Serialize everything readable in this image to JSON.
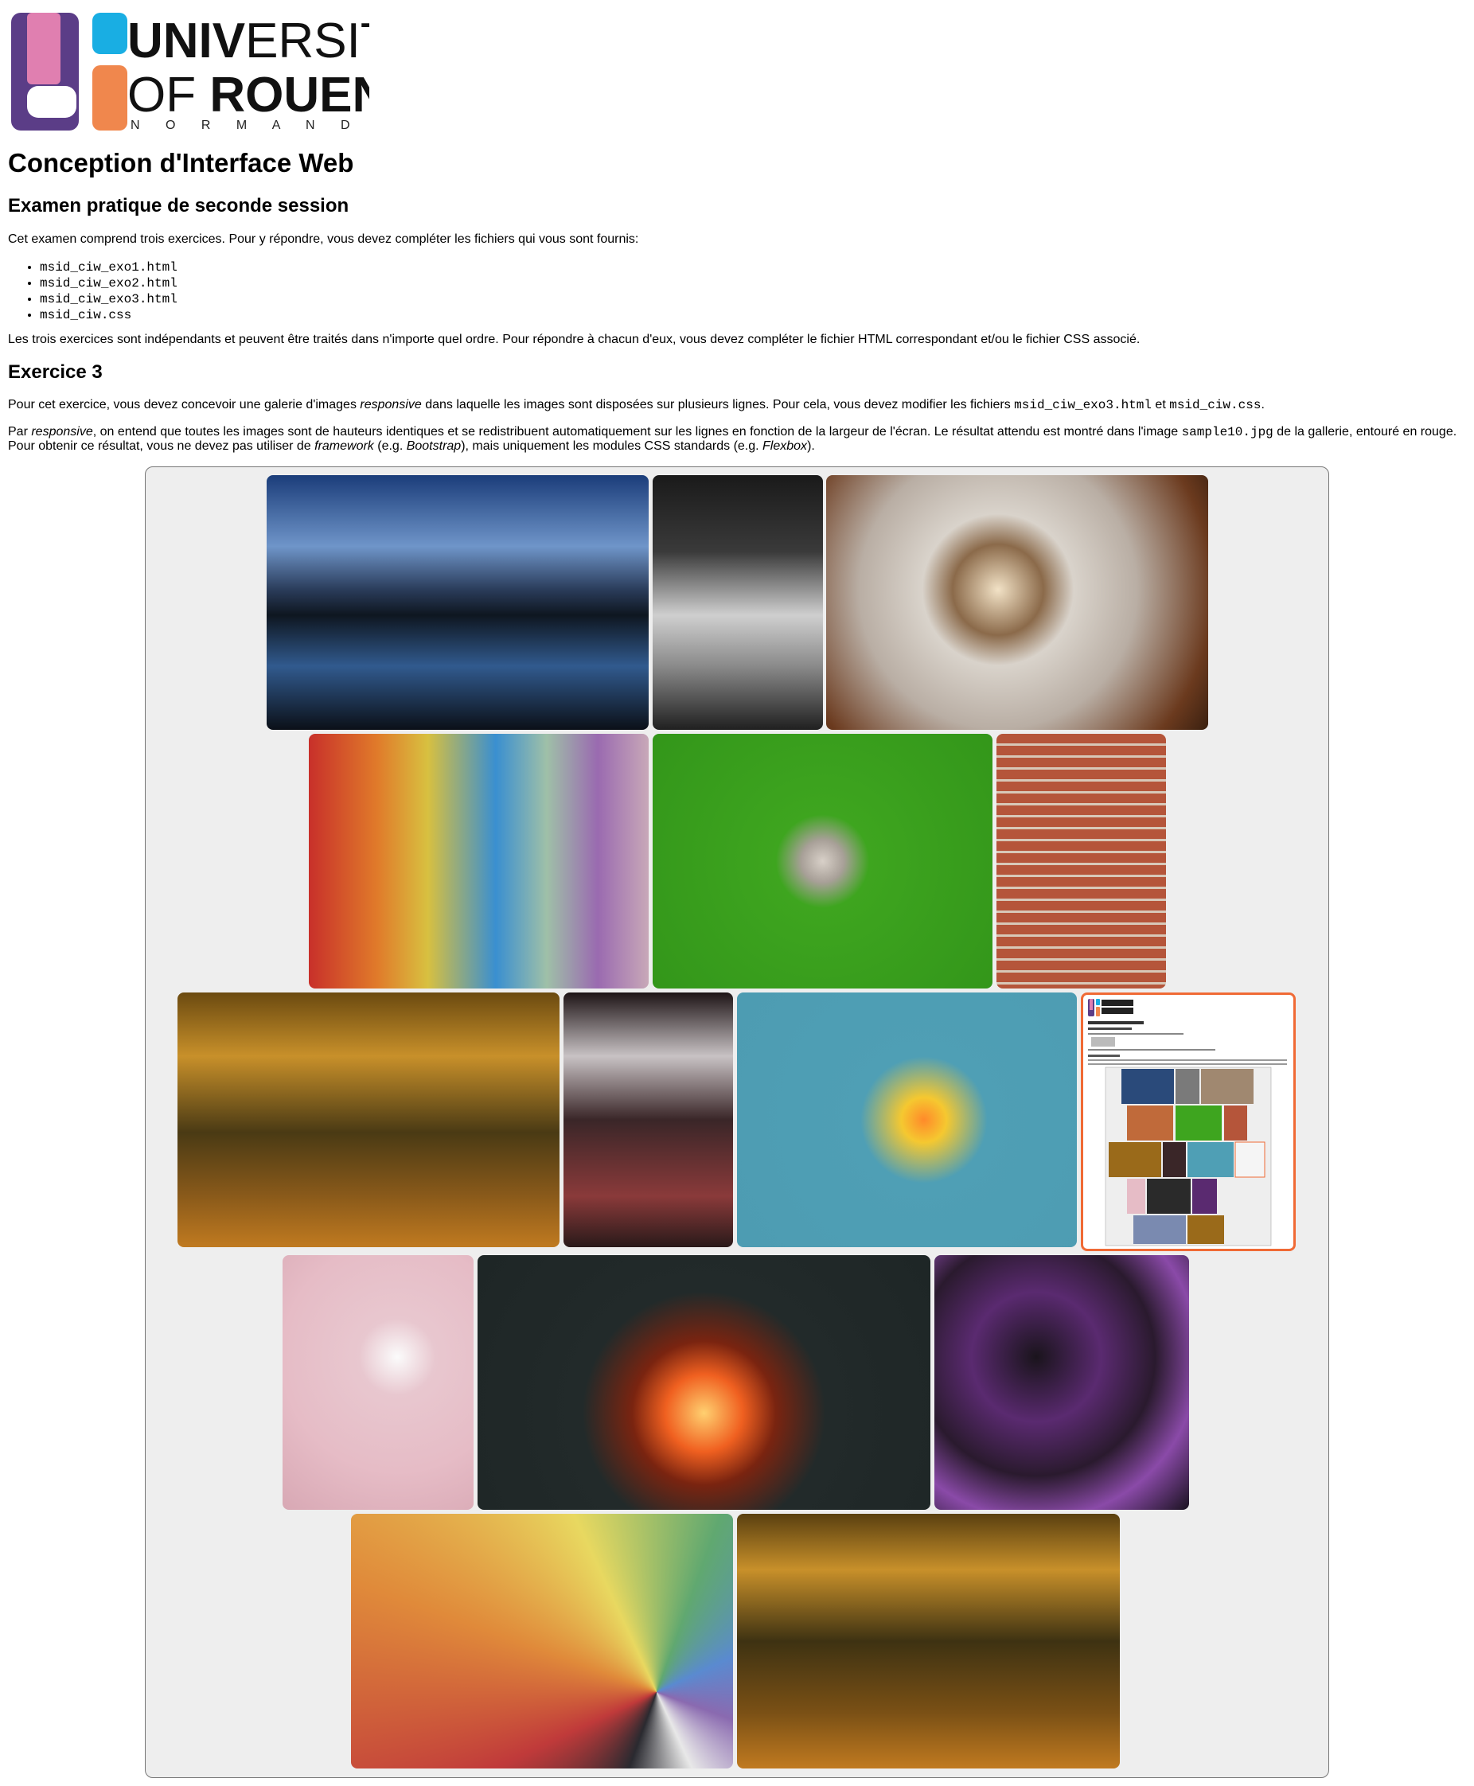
{
  "logo": {
    "line1_bold": "UNIV",
    "line1_light": "ERSITY",
    "line2_light": "OF ",
    "line2_bold": "ROUEN",
    "line3": "N O R M A N D Y",
    "icon": "university-of-rouen-logo",
    "colors": {
      "pink": "#e07fb0",
      "purple": "#5b3d87",
      "cyan": "#19aee3",
      "orange": "#f0874d"
    }
  },
  "heading": "Conception d'Interface Web",
  "subheading": "Examen pratique de seconde session",
  "intro": "Cet examen comprend trois exercices. Pour y répondre, vous devez compléter les fichiers qui vous sont fournis:",
  "files": [
    "msid_ciw_exo1.html",
    "msid_ciw_exo2.html",
    "msid_ciw_exo3.html",
    "msid_ciw.css"
  ],
  "independent": "Les trois exercices sont indépendants et peuvent être traités dans n'importe quel ordre. Pour répondre à chacun d'eux, vous devez compléter le fichier HTML correspondant et/ou le fichier CSS associé.",
  "exercise_title": "Exercice 3",
  "exercise_desc": {
    "p1": "Pour cet exercice, vous devez concevoir une galerie d'images ",
    "em1": "responsive",
    "p2": " dans laquelle les images sont disposées sur plusieurs lignes. Pour cela, vous devez modifier les fichiers ",
    "code1": "msid_ciw_exo3.html",
    "p3": " et ",
    "code2": "msid_ciw.css",
    "p4": "."
  },
  "responsive_desc": {
    "p1": "Par ",
    "em1": "responsive",
    "p2": ", on entend que toutes les images sont de hauteurs identiques et se redistribuent automatiquement sur les lignes en fonction de la largeur de l'écran. Le résultat attendu est montré dans l'image ",
    "code1": "sample10.jpg",
    "p3": " de la gallerie, entouré en rouge. Pour obtenir ce résultat, vous ne devez pas utiliser de ",
    "em2": "framework",
    "p4": " (e.g. ",
    "em3": "Bootstrap",
    "p5": "), mais uniquement les modules CSS standards (e.g. ",
    "em4": "Flexbox",
    "p6": ")."
  },
  "gallery": {
    "highlight_color": "#f06a35",
    "images": [
      {
        "name": "lake-sunset-image",
        "fill": "linear-gradient(180deg,#1b3d7a 0%,#6f95c9 28%,#2a3c5a 45%,#0e1620 55%,#315a8e 75%,#0b1018 100%)"
      },
      {
        "name": "lab-pipettes-image",
        "fill": "linear-gradient(180deg,#1a1a1a 0%,#3a3a3a 30%,#cfcfcf 55%,#8a8a8a 75%,#202020 100%)"
      },
      {
        "name": "coffee-cups-image",
        "fill": "radial-gradient(circle at 45% 45%,#f2e2c6 0%,#8b6a4a 18%,#d9d3cb 30%,#b9aea4 55%,#6b3a1e 85%,#3a2010 100%)"
      },
      {
        "name": "colorful-tiles-image",
        "fill": "linear-gradient(90deg,#c8302a 0%,#e07a2a 20%,#d8c040 35%,#3a8fd0 55%,#9fc0a8 70%,#9a6ab0 85%,#c8a8b8 100%)"
      },
      {
        "name": "green-pills-image",
        "fill": "radial-gradient(circle at 50% 50%,#d8d0c8 0%,#a8a098 10%,#3ea51f 22%,#33961a 100%)"
      },
      {
        "name": "painted-brick-wall-image",
        "fill": "repeating-linear-gradient(180deg,#b5553a 0px,#b5553a 12px,#d8c8b8 12px,#d8c8b8 15px)"
      },
      {
        "name": "autumn-forest-path-image",
        "fill": "linear-gradient(180deg,#6b4a10 0%,#c8902a 25%,#4a3a14 55%,#8a5a1a 80%,#c07a20 100%)"
      },
      {
        "name": "restaurant-window-image",
        "fill": "linear-gradient(180deg,#1e1416 0%,#c8c2c4 25%,#3a2628 50%,#8a3a3a 80%,#2a1a1a 100%)"
      },
      {
        "name": "test-tubes-image",
        "fill": "radial-gradient(circle at 55% 50%,#ff8a2a 0%,#f5c830 10%,#4f9fb5 28%,#4d9cb2 100%)"
      },
      {
        "name": "sample10-screenshot-image",
        "fill": "#ffffff"
      },
      {
        "name": "pigment-dishes-image",
        "fill": "radial-gradient(circle at 60% 40%,#fbfbfb 0%,#e8c7cf 20%,#e6bcc6 60%,#d8a8b4 100%)"
      },
      {
        "name": "campfire-image",
        "fill": "radial-gradient(circle at 50% 62%,#ffd070 0%,#f06020 14%,#7a2410 26%,#222a2a 44%,#1e2626 100%)"
      },
      {
        "name": "purple-abstract-image",
        "fill": "radial-gradient(circle at 40% 40%,#1a141c 0%,#5a2a70 30%,#2a1a2e 55%,#8a4aa8 75%,#1a1220 100%)"
      },
      {
        "name": "color-swatch-fan-image",
        "fill": "conic-gradient(from 200deg at 80% 70%,#2a2a30,#c03a3a,#e08a3a,#e8d860,#60a870,#5a8ad0,#8a6ab0,#e8e8e8,#2a2a30)"
      },
      {
        "name": "autumn-forest-path-image-2",
        "fill": "linear-gradient(180deg,#5a4010 0%,#c8902a 22%,#3e3212 50%,#7a5015 78%,#c07a20 100%)"
      }
    ]
  }
}
